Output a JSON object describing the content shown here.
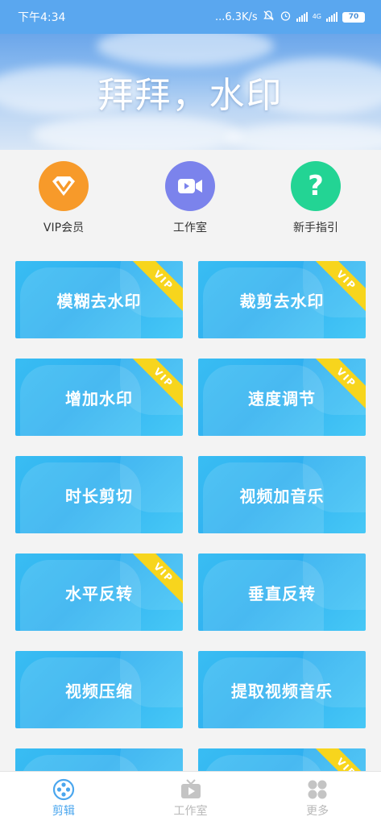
{
  "status_bar": {
    "time": "下午4:34",
    "speed": "...6.3K/s",
    "network": "4G",
    "battery": "70"
  },
  "banner": {
    "title": "拜拜，水印"
  },
  "quick_actions": [
    {
      "label": "VIP会员",
      "icon": "vip-diamond-icon",
      "color": "#f79a2a"
    },
    {
      "label": "工作室",
      "icon": "video-camera-icon",
      "color": "#7b83ec"
    },
    {
      "label": "新手指引",
      "icon": "question-icon",
      "color": "#23d494"
    }
  ],
  "tiles": [
    {
      "label": "模糊去水印",
      "vip": true
    },
    {
      "label": "裁剪去水印",
      "vip": true
    },
    {
      "label": "增加水印",
      "vip": true
    },
    {
      "label": "速度调节",
      "vip": true
    },
    {
      "label": "时长剪切",
      "vip": false
    },
    {
      "label": "视频加音乐",
      "vip": false
    },
    {
      "label": "水平反转",
      "vip": true
    },
    {
      "label": "垂直反转",
      "vip": false
    },
    {
      "label": "视频压缩",
      "vip": false
    },
    {
      "label": "提取视频音乐",
      "vip": false
    },
    {
      "label": "",
      "vip": false
    },
    {
      "label": "",
      "vip": true
    }
  ],
  "vip_ribbon_text": "VIP",
  "bottom_nav": [
    {
      "label": "剪辑",
      "icon": "film-reel-icon",
      "active": true
    },
    {
      "label": "工作室",
      "icon": "tv-icon",
      "active": false
    },
    {
      "label": "更多",
      "icon": "more-grid-icon",
      "active": false
    }
  ],
  "colors": {
    "status_bar": "#5aa7ef",
    "tile": "#2fb0f0",
    "ribbon": "#f7d51d",
    "nav_active": "#4aa6ee",
    "nav_inactive": "#b8b8b8"
  }
}
